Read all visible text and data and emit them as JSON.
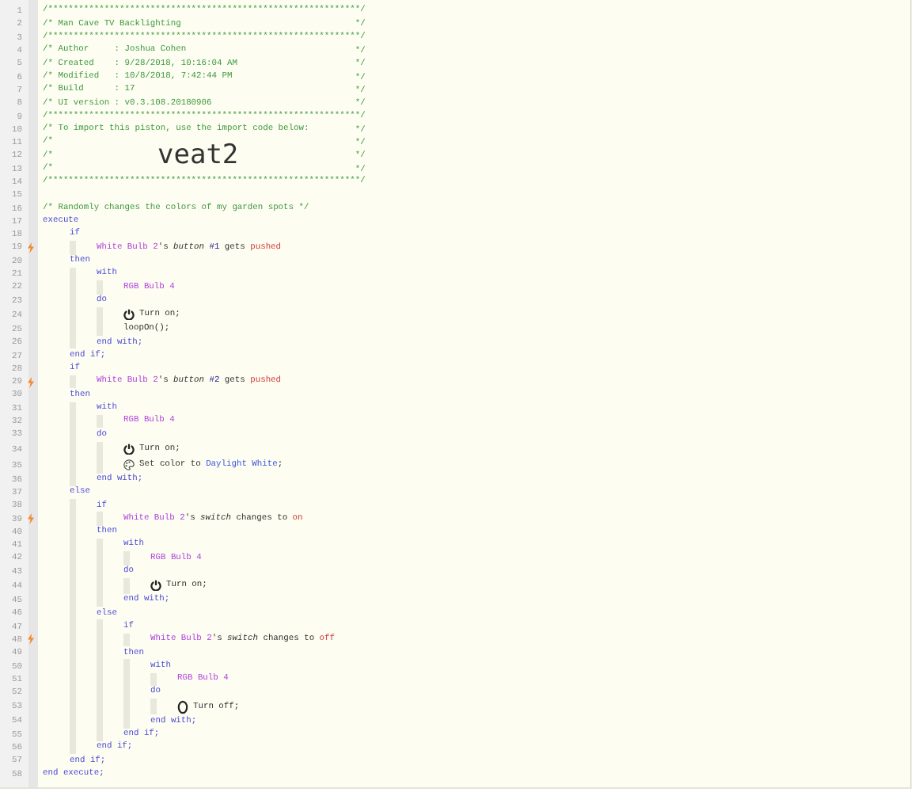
{
  "lines": [
    {
      "number": "1",
      "kind": "code",
      "trigger": false,
      "parts": [
        {
          "text": "/*************************************************************/",
          "kind": "comment"
        }
      ]
    },
    {
      "number": "2",
      "kind": "code",
      "trigger": false,
      "parts": [
        {
          "text": "/* Man Cave TV Backlighting",
          "kind": "comment"
        }
      ],
      "end": "*/"
    },
    {
      "number": "3",
      "kind": "code",
      "trigger": false,
      "parts": [
        {
          "text": "/*************************************************************/",
          "kind": "comment"
        }
      ]
    },
    {
      "number": "4",
      "kind": "code",
      "trigger": false,
      "parts": [
        {
          "text": "/* Author     : Joshua Cohen",
          "kind": "comment"
        }
      ],
      "end": "*/"
    },
    {
      "number": "5",
      "kind": "code",
      "trigger": false,
      "parts": [
        {
          "text": "/* Created    : 9/28/2018, 10:16:04 AM",
          "kind": "comment"
        }
      ],
      "end": "*/"
    },
    {
      "number": "6",
      "kind": "code",
      "trigger": false,
      "parts": [
        {
          "text": "/* Modified   : 10/8/2018, 7:42:44 PM",
          "kind": "comment"
        }
      ],
      "end": "*/"
    },
    {
      "number": "7",
      "kind": "code",
      "trigger": false,
      "parts": [
        {
          "text": "/* Build      : 17",
          "kind": "comment"
        }
      ],
      "end": "*/"
    },
    {
      "number": "8",
      "kind": "code",
      "trigger": false,
      "parts": [
        {
          "text": "/* UI version : v0.3.108.20180906",
          "kind": "comment"
        }
      ],
      "end": "*/"
    },
    {
      "number": "9",
      "kind": "code",
      "trigger": false,
      "parts": [
        {
          "text": "/*************************************************************/",
          "kind": "comment"
        }
      ]
    },
    {
      "number": "10",
      "kind": "code",
      "trigger": false,
      "parts": [
        {
          "text": "/* To import this piston, use the import code below:",
          "kind": "comment"
        }
      ],
      "end": "*/"
    },
    {
      "number": "11",
      "kind": "code",
      "trigger": false,
      "parts": [
        {
          "text": "/*",
          "kind": "comment"
        }
      ],
      "end": "*/"
    },
    {
      "number": "12",
      "kind": "code",
      "trigger": false,
      "parts": [
        {
          "text": "/*",
          "kind": "comment"
        },
        {
          "text": "veat2",
          "kind": "import-code"
        }
      ],
      "end": "*/"
    },
    {
      "number": "13",
      "kind": "code",
      "trigger": false,
      "parts": [
        {
          "text": "/*",
          "kind": "comment"
        }
      ],
      "end": "*/"
    },
    {
      "number": "14",
      "kind": "code",
      "trigger": false,
      "parts": [
        {
          "text": "/*************************************************************/",
          "kind": "comment"
        }
      ]
    },
    {
      "number": "15",
      "kind": "code",
      "trigger": false
    },
    {
      "number": "16",
      "kind": "code",
      "trigger": false,
      "parts": [
        {
          "text": "/* Randomly changes the colors of my garden spots */",
          "kind": "comment"
        }
      ]
    },
    {
      "number": "17",
      "kind": "code",
      "trigger": false,
      "parts": [
        {
          "text": "execute",
          "kind": "keyword"
        }
      ],
      "children": [
        {
          "number": "18",
          "kind": "code",
          "trigger": false,
          "parts": [
            {
              "text": "if",
              "kind": "keyword"
            }
          ],
          "children": [
            {
              "number": "19",
              "kind": "code",
              "trigger": true,
              "parts": [
                {
                  "text": "White Bulb 2",
                  "kind": "device"
                },
                {
                  "text": "'s",
                  "kind": "plain"
                },
                {
                  "text": "button",
                  "kind": "attribute"
                },
                {
                  "text": "#1",
                  "kind": "number"
                },
                {
                  "text": "gets",
                  "kind": "plain"
                },
                {
                  "text": "pushed",
                  "kind": "value"
                }
              ]
            }
          ]
        },
        {
          "number": "20",
          "kind": "code",
          "trigger": false,
          "parts": [
            {
              "text": "then",
              "kind": "keyword"
            }
          ],
          "children": [
            {
              "number": "21",
              "kind": "code",
              "trigger": false,
              "parts": [
                {
                  "text": "with",
                  "kind": "keyword"
                }
              ],
              "children": [
                {
                  "number": "22",
                  "kind": "code",
                  "trigger": false,
                  "parts": [
                    {
                      "text": "RGB Bulb 4",
                      "kind": "device"
                    }
                  ]
                }
              ]
            },
            {
              "number": "23",
              "kind": "code",
              "trigger": false,
              "parts": [
                {
                  "text": "do",
                  "kind": "keyword"
                }
              ],
              "children": [
                {
                  "number": "24",
                  "kind": "power",
                  "trigger": false,
                  "parts": [
                    {
                      "text": "Turn on;",
                      "kind": "plain"
                    }
                  ]
                },
                {
                  "number": "25",
                  "kind": "code",
                  "trigger": false,
                  "parts": [
                    {
                      "text": "loopOn();",
                      "kind": "plain"
                    }
                  ]
                }
              ]
            },
            {
              "number": "26",
              "kind": "code",
              "trigger": false,
              "parts": [
                {
                  "text": "end with;",
                  "kind": "keyword"
                }
              ]
            }
          ]
        },
        {
          "number": "27",
          "kind": "code",
          "trigger": false,
          "parts": [
            {
              "text": "end if;",
              "kind": "keyword"
            }
          ]
        },
        {
          "number": "28",
          "kind": "code",
          "trigger": false,
          "parts": [
            {
              "text": "if",
              "kind": "keyword"
            }
          ],
          "children": [
            {
              "number": "29",
              "kind": "code",
              "trigger": true,
              "parts": [
                {
                  "text": "White Bulb 2",
                  "kind": "device"
                },
                {
                  "text": "'s",
                  "kind": "plain"
                },
                {
                  "text": "button",
                  "kind": "attribute"
                },
                {
                  "text": "#2",
                  "kind": "number"
                },
                {
                  "text": "gets",
                  "kind": "plain"
                },
                {
                  "text": "pushed",
                  "kind": "value"
                }
              ]
            }
          ]
        },
        {
          "number": "30",
          "kind": "code",
          "trigger": false,
          "parts": [
            {
              "text": "then",
              "kind": "keyword"
            }
          ],
          "children": [
            {
              "number": "31",
              "kind": "code",
              "trigger": false,
              "parts": [
                {
                  "text": "with",
                  "kind": "keyword"
                }
              ],
              "children": [
                {
                  "number": "32",
                  "kind": "code",
                  "trigger": false,
                  "parts": [
                    {
                      "text": "RGB Bulb 4",
                      "kind": "device"
                    }
                  ]
                }
              ]
            },
            {
              "number": "33",
              "kind": "code",
              "trigger": false,
              "parts": [
                {
                  "text": "do",
                  "kind": "keyword"
                }
              ],
              "children": [
                {
                  "number": "34",
                  "kind": "power",
                  "trigger": false,
                  "parts": [
                    {
                      "text": "Turn on;",
                      "kind": "plain"
                    }
                  ]
                },
                {
                  "number": "35",
                  "kind": "color",
                  "trigger": false,
                  "parts": [
                    {
                      "text": "Set color to",
                      "kind": "plain"
                    },
                    {
                      "text": "Daylight White",
                      "kind": "constant"
                    },
                    {
                      "text": ";",
                      "kind": "tail"
                    }
                  ]
                }
              ]
            },
            {
              "number": "36",
              "kind": "code",
              "trigger": false,
              "parts": [
                {
                  "text": "end with;",
                  "kind": "keyword"
                }
              ]
            }
          ]
        },
        {
          "number": "37",
          "kind": "code",
          "trigger": false,
          "parts": [
            {
              "text": "else",
              "kind": "keyword"
            }
          ],
          "children": [
            {
              "number": "38",
              "kind": "code",
              "trigger": false,
              "parts": [
                {
                  "text": "if",
                  "kind": "keyword"
                }
              ],
              "children": [
                {
                  "number": "39",
                  "kind": "code",
                  "trigger": true,
                  "parts": [
                    {
                      "text": "White Bulb 2",
                      "kind": "device"
                    },
                    {
                      "text": "'s",
                      "kind": "plain"
                    },
                    {
                      "text": "switch",
                      "kind": "attribute"
                    },
                    {
                      "text": "changes to",
                      "kind": "plain"
                    },
                    {
                      "text": "on",
                      "kind": "value"
                    }
                  ]
                }
              ]
            },
            {
              "number": "40",
              "kind": "code",
              "trigger": false,
              "parts": [
                {
                  "text": "then",
                  "kind": "keyword"
                }
              ],
              "children": [
                {
                  "number": "41",
                  "kind": "code",
                  "trigger": false,
                  "parts": [
                    {
                      "text": "with",
                      "kind": "keyword"
                    }
                  ],
                  "children": [
                    {
                      "number": "42",
                      "kind": "code",
                      "trigger": false,
                      "parts": [
                        {
                          "text": "RGB Bulb 4",
                          "kind": "device"
                        }
                      ]
                    }
                  ]
                },
                {
                  "number": "43",
                  "kind": "code",
                  "trigger": false,
                  "parts": [
                    {
                      "text": "do",
                      "kind": "keyword"
                    }
                  ],
                  "children": [
                    {
                      "number": "44",
                      "kind": "power",
                      "trigger": false,
                      "parts": [
                        {
                          "text": "Turn on;",
                          "kind": "plain"
                        }
                      ]
                    }
                  ]
                },
                {
                  "number": "45",
                  "kind": "code",
                  "trigger": false,
                  "parts": [
                    {
                      "text": "end with;",
                      "kind": "keyword"
                    }
                  ]
                }
              ]
            },
            {
              "number": "46",
              "kind": "code",
              "trigger": false,
              "parts": [
                {
                  "text": "else",
                  "kind": "keyword"
                }
              ],
              "children": [
                {
                  "number": "47",
                  "kind": "code",
                  "trigger": false,
                  "parts": [
                    {
                      "text": "if",
                      "kind": "keyword"
                    }
                  ],
                  "children": [
                    {
                      "number": "48",
                      "kind": "code",
                      "trigger": true,
                      "parts": [
                        {
                          "text": "White Bulb 2",
                          "kind": "device"
                        },
                        {
                          "text": "'s",
                          "kind": "plain"
                        },
                        {
                          "text": "switch",
                          "kind": "attribute"
                        },
                        {
                          "text": "changes to",
                          "kind": "plain"
                        },
                        {
                          "text": "off",
                          "kind": "value"
                        }
                      ]
                    }
                  ]
                },
                {
                  "number": "49",
                  "kind": "code",
                  "trigger": false,
                  "parts": [
                    {
                      "text": "then",
                      "kind": "keyword"
                    }
                  ],
                  "children": [
                    {
                      "number": "50",
                      "kind": "code",
                      "trigger": false,
                      "parts": [
                        {
                          "text": "with",
                          "kind": "keyword"
                        }
                      ],
                      "children": [
                        {
                          "number": "51",
                          "kind": "code",
                          "trigger": false,
                          "parts": [
                            {
                              "text": "RGB Bulb 4",
                              "kind": "device"
                            }
                          ]
                        }
                      ]
                    },
                    {
                      "number": "52",
                      "kind": "code",
                      "trigger": false,
                      "parts": [
                        {
                          "text": "do",
                          "kind": "keyword"
                        }
                      ],
                      "children": [
                        {
                          "number": "53",
                          "kind": "off",
                          "trigger": false,
                          "parts": [
                            {
                              "text": "Turn off;",
                              "kind": "plain"
                            }
                          ]
                        }
                      ]
                    },
                    {
                      "number": "54",
                      "kind": "code",
                      "trigger": false,
                      "parts": [
                        {
                          "text": "end with;",
                          "kind": "keyword"
                        }
                      ]
                    }
                  ]
                },
                {
                  "number": "55",
                  "kind": "code",
                  "trigger": false,
                  "parts": [
                    {
                      "text": "end if;",
                      "kind": "keyword"
                    }
                  ]
                }
              ]
            },
            {
              "number": "56",
              "kind": "code",
              "trigger": false,
              "parts": [
                {
                  "text": "end if;",
                  "kind": "keyword"
                }
              ]
            }
          ]
        },
        {
          "number": "57",
          "kind": "code",
          "trigger": false,
          "parts": [
            {
              "text": "end if;",
              "kind": "keyword"
            }
          ]
        }
      ]
    },
    {
      "number": "58",
      "kind": "code",
      "trigger": false,
      "parts": [
        {
          "text": "end execute;",
          "kind": "keyword"
        }
      ]
    }
  ]
}
